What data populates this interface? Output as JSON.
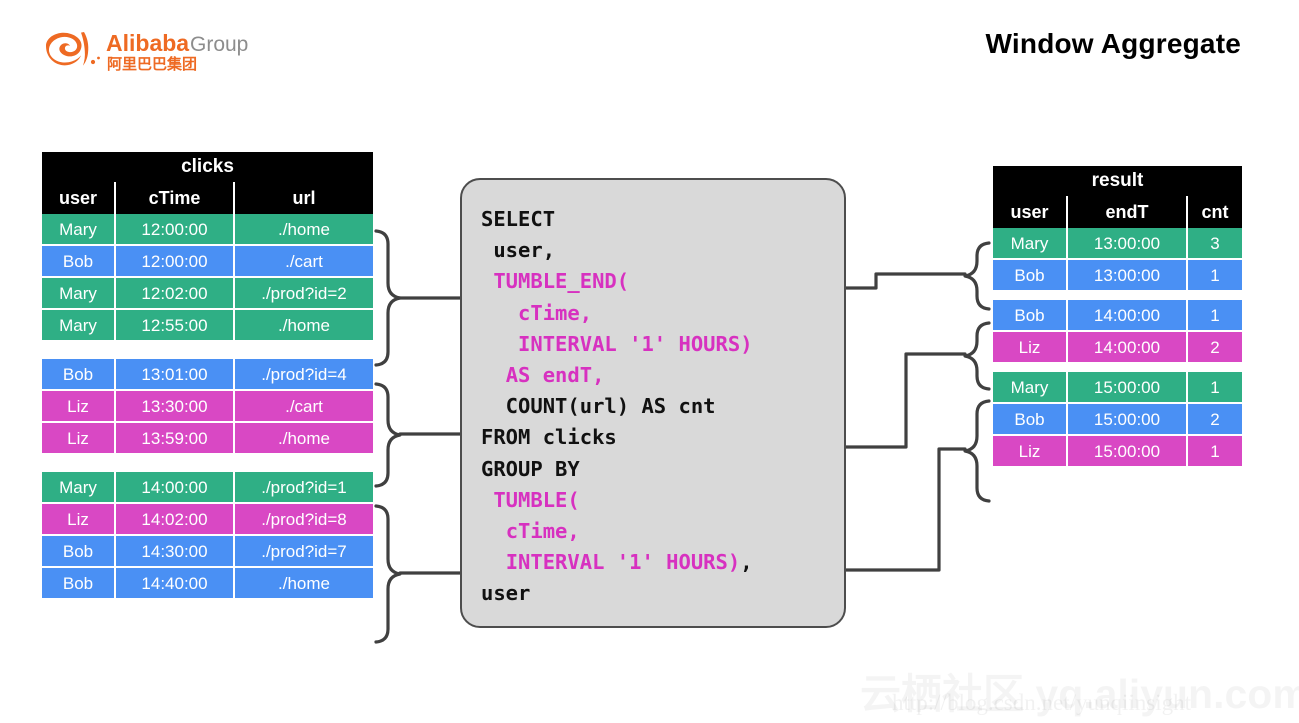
{
  "header": {
    "title": "Window Aggregate",
    "logo_name_en": "Alibaba",
    "logo_suffix_en": "Group",
    "logo_name_cn": "阿里巴巴集团"
  },
  "colors": {
    "green": "#2FAF85",
    "blue": "#4A90F4",
    "pink": "#D948C4",
    "sql_keyword": "#D731C0",
    "sql_bg": "#D9D9D9",
    "sql_border": "#4D4D4D",
    "header_bg": "#000000",
    "logo_orange": "#EE6A23"
  },
  "clicks_table": {
    "title": "clicks",
    "columns": [
      "user",
      "cTime",
      "url"
    ],
    "groups": [
      {
        "rows": [
          {
            "user": "Mary",
            "cTime": "12:00:00",
            "url": "./home",
            "color": "green"
          },
          {
            "user": "Bob",
            "cTime": "12:00:00",
            "url": "./cart",
            "color": "blue"
          },
          {
            "user": "Mary",
            "cTime": "12:02:00",
            "url": "./prod?id=2",
            "color": "green"
          },
          {
            "user": "Mary",
            "cTime": "12:55:00",
            "url": "./home",
            "color": "green"
          }
        ]
      },
      {
        "rows": [
          {
            "user": "Bob",
            "cTime": "13:01:00",
            "url": "./prod?id=4",
            "color": "blue"
          },
          {
            "user": "Liz",
            "cTime": "13:30:00",
            "url": "./cart",
            "color": "pink"
          },
          {
            "user": "Liz",
            "cTime": "13:59:00",
            "url": "./home",
            "color": "pink"
          }
        ]
      },
      {
        "rows": [
          {
            "user": "Mary",
            "cTime": "14:00:00",
            "url": "./prod?id=1",
            "color": "green"
          },
          {
            "user": "Liz",
            "cTime": "14:02:00",
            "url": "./prod?id=8",
            "color": "pink"
          },
          {
            "user": "Bob",
            "cTime": "14:30:00",
            "url": "./prod?id=7",
            "color": "blue"
          },
          {
            "user": "Bob",
            "cTime": "14:40:00",
            "url": "./home",
            "color": "blue"
          }
        ]
      }
    ]
  },
  "result_table": {
    "title": "result",
    "columns": [
      "user",
      "endT",
      "cnt"
    ],
    "groups": [
      {
        "rows": [
          {
            "user": "Mary",
            "endT": "13:00:00",
            "cnt": "3",
            "color": "green"
          },
          {
            "user": "Bob",
            "endT": "13:00:00",
            "cnt": "1",
            "color": "blue"
          }
        ]
      },
      {
        "rows": [
          {
            "user": "Bob",
            "endT": "14:00:00",
            "cnt": "1",
            "color": "blue"
          },
          {
            "user": "Liz",
            "endT": "14:00:00",
            "cnt": "2",
            "color": "pink"
          }
        ]
      },
      {
        "rows": [
          {
            "user": "Mary",
            "endT": "15:00:00",
            "cnt": "1",
            "color": "green"
          },
          {
            "user": "Bob",
            "endT": "15:00:00",
            "cnt": "2",
            "color": "blue"
          },
          {
            "user": "Liz",
            "endT": "15:00:00",
            "cnt": "1",
            "color": "pink"
          }
        ]
      }
    ]
  },
  "sql": {
    "lines": [
      {
        "segments": [
          {
            "t": "SELECT",
            "kw": false
          }
        ]
      },
      {
        "segments": [
          {
            "t": " user,",
            "kw": false
          }
        ]
      },
      {
        "segments": [
          {
            "t": " ",
            "kw": false
          },
          {
            "t": "TUMBLE_END(",
            "kw": true
          }
        ]
      },
      {
        "segments": [
          {
            "t": "   ",
            "kw": false
          },
          {
            "t": "cTime,",
            "kw": true
          }
        ]
      },
      {
        "segments": [
          {
            "t": "   ",
            "kw": false
          },
          {
            "t": "INTERVAL '1' HOURS)",
            "kw": true
          }
        ]
      },
      {
        "segments": [
          {
            "t": "  ",
            "kw": false
          },
          {
            "t": "AS endT,",
            "kw": true
          }
        ]
      },
      {
        "segments": [
          {
            "t": "  COUNT(url) AS cnt",
            "kw": false
          }
        ]
      },
      {
        "segments": [
          {
            "t": "FROM clicks",
            "kw": false
          }
        ]
      },
      {
        "segments": [
          {
            "t": "GROUP BY",
            "kw": false
          }
        ]
      },
      {
        "segments": [
          {
            "t": " ",
            "kw": false
          },
          {
            "t": "TUMBLE(",
            "kw": true
          }
        ]
      },
      {
        "segments": [
          {
            "t": "  ",
            "kw": false
          },
          {
            "t": "cTime,",
            "kw": true
          }
        ]
      },
      {
        "segments": [
          {
            "t": "  ",
            "kw": false
          },
          {
            "t": "INTERVAL '1' HOURS)",
            "kw": true
          },
          {
            "t": ",",
            "kw": false
          }
        ]
      },
      {
        "segments": [
          {
            "t": "user",
            "kw": false
          }
        ]
      }
    ]
  },
  "watermark": {
    "big": "云栖社区 yq.aliyun.com",
    "small": "http://blog.csdn.net/yunqiinsight"
  }
}
